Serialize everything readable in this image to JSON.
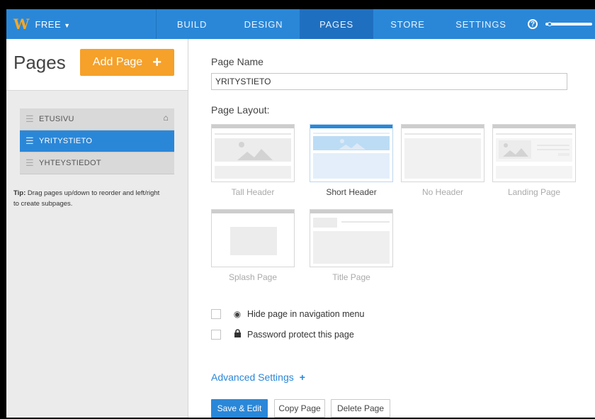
{
  "topbar": {
    "logo": "W",
    "plan": "FREE",
    "tabs": [
      {
        "label": "BUILD"
      },
      {
        "label": "DESIGN"
      },
      {
        "label": "PAGES",
        "active": true
      },
      {
        "label": "STORE"
      },
      {
        "label": "SETTINGS"
      }
    ],
    "help": "?",
    "setup_progress": 0.05
  },
  "sidebar": {
    "title": "Pages",
    "add_button": "Add Page",
    "add_plus": "+",
    "pages": [
      {
        "label": "ETUSIVU",
        "home": true
      },
      {
        "label": "YRITYSTIETO",
        "active": true
      },
      {
        "label": "YHTEYSTIEDOT"
      }
    ],
    "tip_label": "Tip:",
    "tip_text": " Drag pages up/down to reorder and left/right to create subpages."
  },
  "main": {
    "page_name_label": "Page Name",
    "page_name_value": "YRITYSTIETO",
    "page_layout_label": "Page Layout:",
    "layouts": [
      {
        "label": "Tall Header"
      },
      {
        "label": "Short Header",
        "selected": true
      },
      {
        "label": "No Header"
      },
      {
        "label": "Landing Page"
      },
      {
        "label": "Splash Page"
      },
      {
        "label": "Title Page"
      }
    ],
    "options": [
      {
        "label": "Hide page in navigation menu",
        "icon": "eye-slash-icon",
        "checked": false
      },
      {
        "label": "Password protect this page",
        "icon": "lock-icon",
        "checked": false
      }
    ],
    "advanced_settings": "Advanced Settings",
    "advanced_plus": "+",
    "buttons": {
      "save": "Save & Edit",
      "copy": "Copy Page",
      "delete": "Delete Page"
    }
  },
  "colors": {
    "brand_blue": "#2a87d8",
    "accent_orange": "#f5a12a",
    "logo_orange": "#f6a826"
  }
}
